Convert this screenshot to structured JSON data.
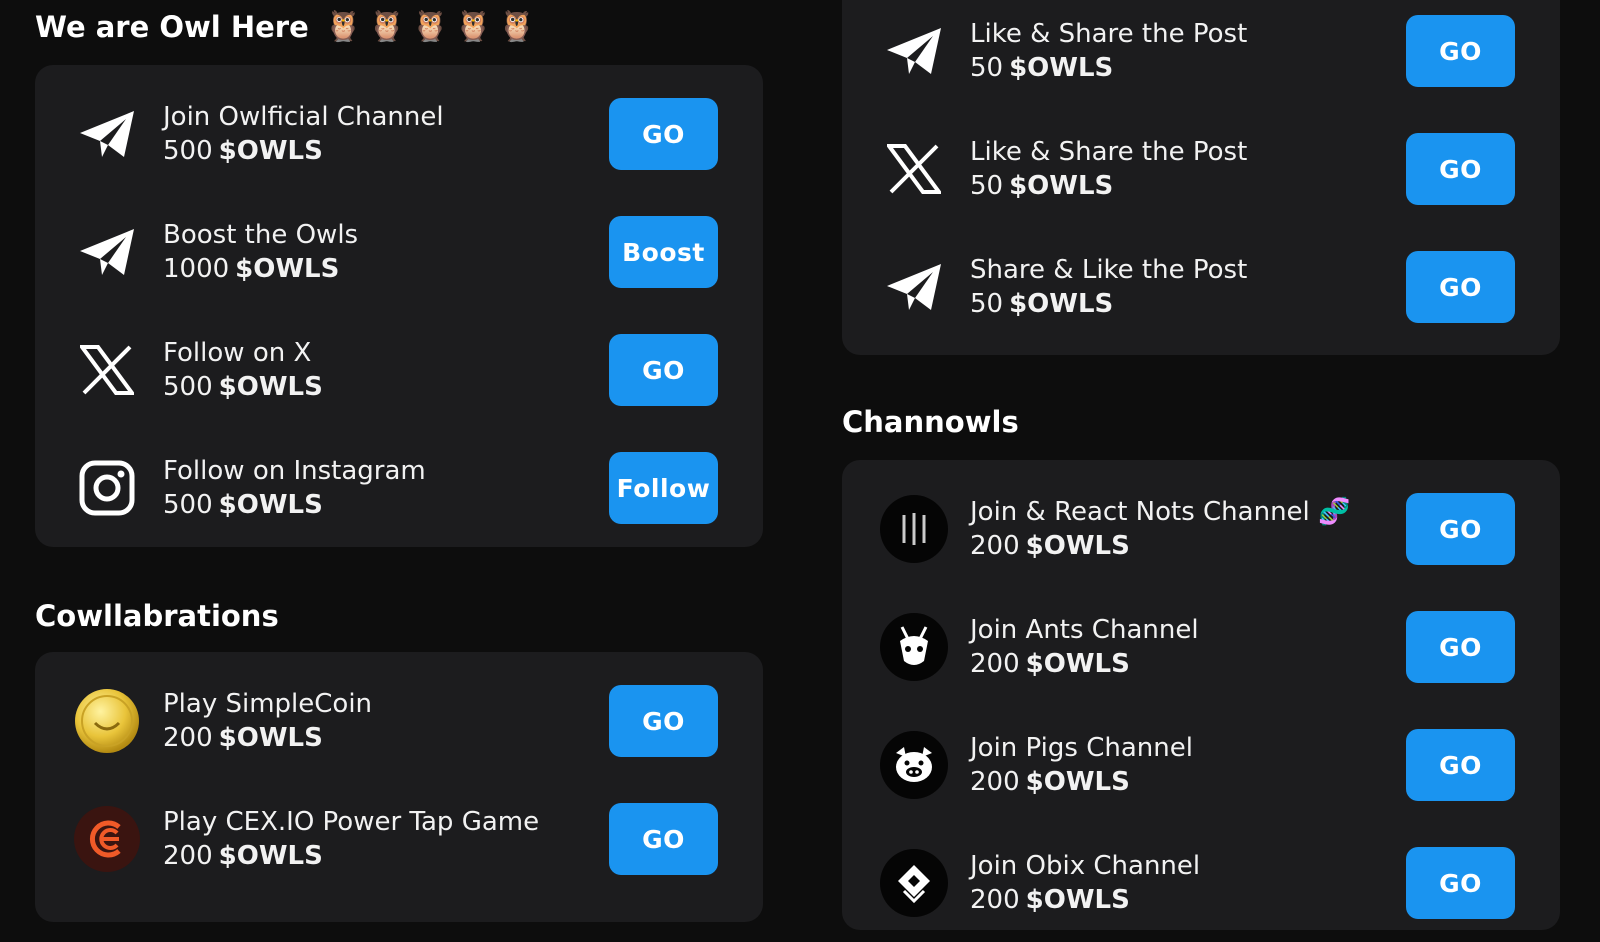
{
  "main_section": {
    "title": "We are Owl Here",
    "owl_emojis": [
      "🦉",
      "🦉",
      "🦉",
      "🦉",
      "🦉"
    ],
    "tasks": [
      {
        "icon": "telegram-icon",
        "title": "Join Owlficial Channel",
        "amount": "500",
        "currency": "$OWLS",
        "button": "GO"
      },
      {
        "icon": "telegram-icon",
        "title": "Boost the Owls",
        "amount": "1000",
        "currency": "$OWLS",
        "button": "Boost"
      },
      {
        "icon": "x-icon",
        "title": "Follow on X",
        "amount": "500",
        "currency": "$OWLS",
        "button": "GO"
      },
      {
        "icon": "instagram-icon",
        "title": "Follow on Instagram",
        "amount": "500",
        "currency": "$OWLS",
        "button": "Follow"
      }
    ]
  },
  "collab_section": {
    "title": "Cowllabrations",
    "tasks": [
      {
        "icon": "simplecoin-logo-icon",
        "title": "Play SimpleCoin",
        "amount": "200",
        "currency": "$OWLS",
        "button": "GO"
      },
      {
        "icon": "cexio-logo-icon",
        "title": "Play CEX.IO Power Tap Game",
        "amount": "200",
        "currency": "$OWLS",
        "button": "GO"
      }
    ]
  },
  "social_section": {
    "tasks": [
      {
        "icon": "telegram-icon",
        "title": "Like & Share the Post",
        "amount": "50",
        "currency": "$OWLS",
        "button": "GO"
      },
      {
        "icon": "x-icon",
        "title": "Like & Share the Post",
        "amount": "50",
        "currency": "$OWLS",
        "button": "GO"
      },
      {
        "icon": "telegram-icon",
        "title": "Share & Like the Post",
        "amount": "50",
        "currency": "$OWLS",
        "button": "GO"
      }
    ]
  },
  "channels_section": {
    "title": "Channowls",
    "tasks": [
      {
        "icon": "nots-logo-icon",
        "title": "Join & React Nots Channel",
        "title_emoji": "🧬",
        "amount": "200",
        "currency": "$OWLS",
        "button": "GO"
      },
      {
        "icon": "ants-logo-icon",
        "title": "Join Ants Channel",
        "amount": "200",
        "currency": "$OWLS",
        "button": "GO"
      },
      {
        "icon": "pigs-logo-icon",
        "title": "Join Pigs Channel",
        "amount": "200",
        "currency": "$OWLS",
        "button": "GO"
      },
      {
        "icon": "obix-logo-icon",
        "title": "Join Obix Channel",
        "amount": "200",
        "currency": "$OWLS",
        "button": "GO"
      }
    ]
  },
  "colors": {
    "background": "#0d0d0d",
    "card": "#1c1c1e",
    "button": "#1a94f0",
    "text": "#f2f2f2"
  }
}
